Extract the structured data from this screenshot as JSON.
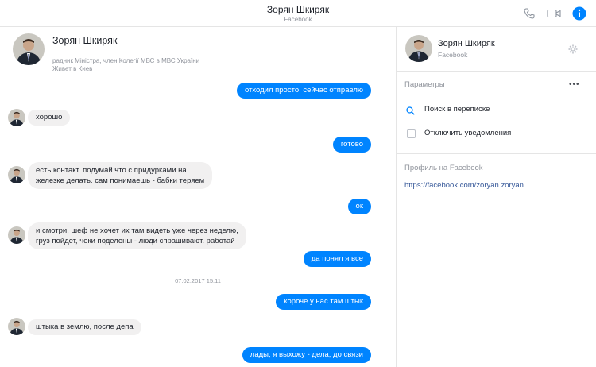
{
  "header": {
    "title": "Зорян Шкиряк",
    "subtitle": "Facebook"
  },
  "profile": {
    "name": "Зорян Шкиряк",
    "info_line1": "радник Міністра, член Колегії МВС в МВС України",
    "info_line2": "Живет в Киев"
  },
  "messages": [
    {
      "dir": "out",
      "text": "отходил просто, сейчас отправлю"
    },
    {
      "dir": "in",
      "text": "хорошо"
    },
    {
      "dir": "out",
      "text": "готово"
    },
    {
      "dir": "in",
      "line1": "есть контакт. подумай что с придурками на",
      "line2": "железке делать. сам понимаешь - бабки теряем"
    },
    {
      "dir": "out",
      "text": "ок"
    },
    {
      "dir": "in",
      "line1": "и смотри, шеф не хочет их там видеть уже через неделю,",
      "line2": "груз пойдет, чеки поделены - люди спрашивают. работай"
    },
    {
      "dir": "out",
      "text": "да понял я все"
    },
    {
      "dir": "out",
      "text": "короче у нас там штык"
    },
    {
      "dir": "in",
      "text": "штыка в землю, после депа"
    },
    {
      "dir": "out",
      "text": "лады, я выхожу - дела, до связи"
    }
  ],
  "timestamp": "07.02.2017 15:11",
  "sidebar": {
    "name": "Зорян Шкиряк",
    "sub": "Facebook",
    "params_label": "Параметры",
    "more_label": "•••",
    "search_label": "Поиск в переписке",
    "mute_label": "Отключить уведомления",
    "profile_label": "Профиль на Facebook",
    "profile_link": "https://facebook.com/zoryan.zoryan"
  },
  "colors": {
    "accent": "#0084ff",
    "incoming_bubble": "#f1f0f0",
    "link": "#365899"
  }
}
